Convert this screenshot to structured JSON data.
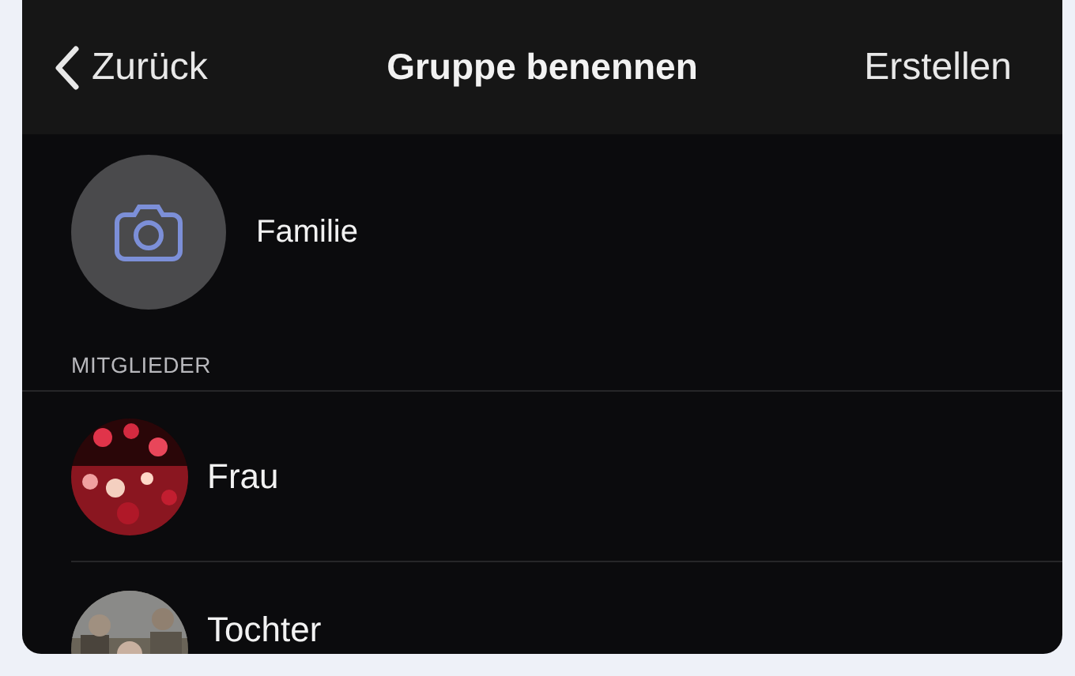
{
  "header": {
    "back": "Zurück",
    "title": "Gruppe benennen",
    "action": "Erstellen"
  },
  "group": {
    "name": "Familie"
  },
  "section_label": "MITGLIEDER",
  "members": [
    {
      "name": "Frau",
      "kind": "red"
    },
    {
      "name": "Tochter",
      "kind": "family"
    }
  ]
}
